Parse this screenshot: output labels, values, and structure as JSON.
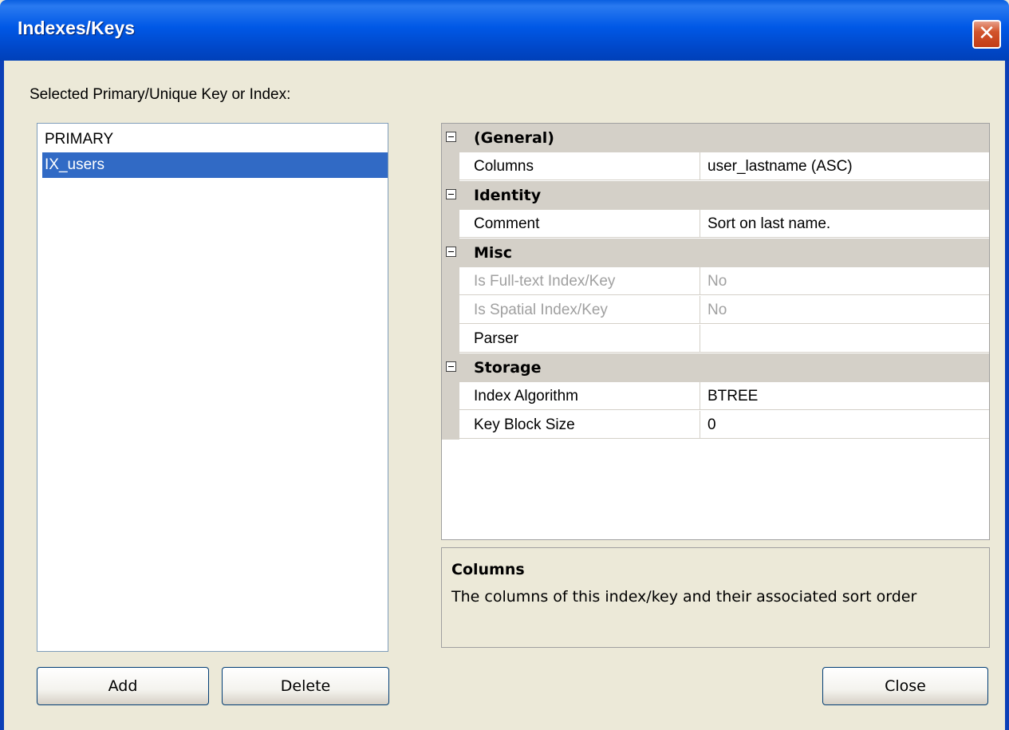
{
  "window": {
    "title": "Indexes/Keys"
  },
  "label_selected": "Selected Primary/Unique Key or Index:",
  "keys": [
    {
      "name": "PRIMARY",
      "selected": false
    },
    {
      "name": "IX_users",
      "selected": true
    }
  ],
  "properties": {
    "general": {
      "title": "(General)",
      "columns_label": "Columns",
      "columns_value": "user_lastname (ASC)"
    },
    "identity": {
      "title": "Identity",
      "comment_label": "Comment",
      "comment_value": "Sort on last name."
    },
    "misc": {
      "title": "Misc",
      "fulltext_label": "Is Full-text Index/Key",
      "fulltext_value": "No",
      "spatial_label": "Is Spatial Index/Key",
      "spatial_value": "No",
      "parser_label": "Parser",
      "parser_value": ""
    },
    "storage": {
      "title": "Storage",
      "algorithm_label": "Index Algorithm",
      "algorithm_value": "BTREE",
      "blocksize_label": "Key Block Size",
      "blocksize_value": "0"
    }
  },
  "description": {
    "title": "Columns",
    "text": "The columns of this index/key and their associated sort order"
  },
  "buttons": {
    "add": "Add",
    "delete": "Delete",
    "close": "Close"
  },
  "colors": {
    "title_bar": "#0058e6",
    "selection": "#316ac5",
    "dialog_bg": "#ece9d8",
    "category_bg": "#d4d0c8"
  },
  "icons": {
    "close": "close-icon",
    "collapse": "collapse-icon"
  }
}
